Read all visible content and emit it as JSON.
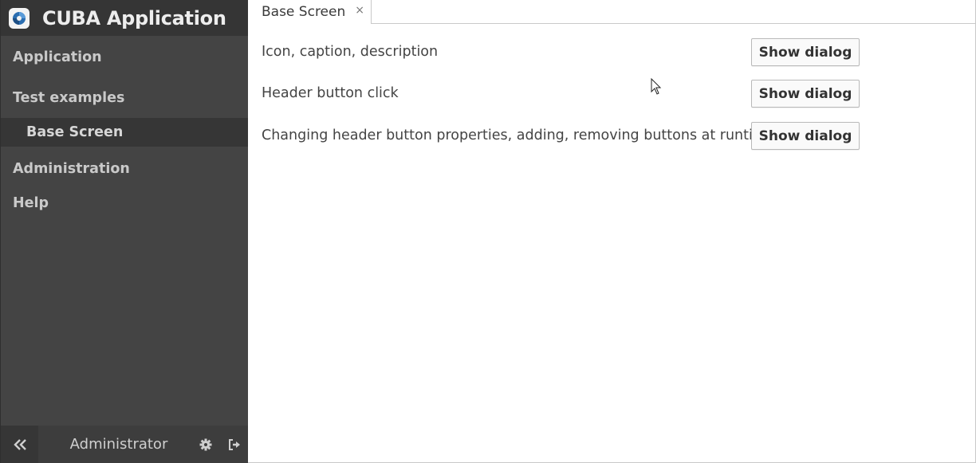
{
  "app": {
    "title": "CUBA Application",
    "logo_icon": "cuba-logo-icon"
  },
  "sidebar": {
    "items": [
      {
        "label": "Application"
      },
      {
        "label": "Test examples"
      },
      {
        "label": "Base Screen"
      },
      {
        "label": "Administration"
      },
      {
        "label": "Help"
      }
    ],
    "footer": {
      "user": "Administrator",
      "collapse_icon": "double-chevron-left-icon",
      "settings_icon": "gear-icon",
      "logout_icon": "logout-icon"
    }
  },
  "tabs": [
    {
      "label": "Base Screen",
      "close": "×"
    }
  ],
  "rows": [
    {
      "label": "Icon, caption, description",
      "button": "Show dialog"
    },
    {
      "label": "Header button click",
      "button": "Show dialog"
    },
    {
      "label": "Changing header button properties, adding, removing buttons at runtime",
      "button": "Show dialog"
    }
  ],
  "colors": {
    "sidebar": "#444444",
    "sidebar_header": "#353535",
    "active_item": "#363636"
  }
}
